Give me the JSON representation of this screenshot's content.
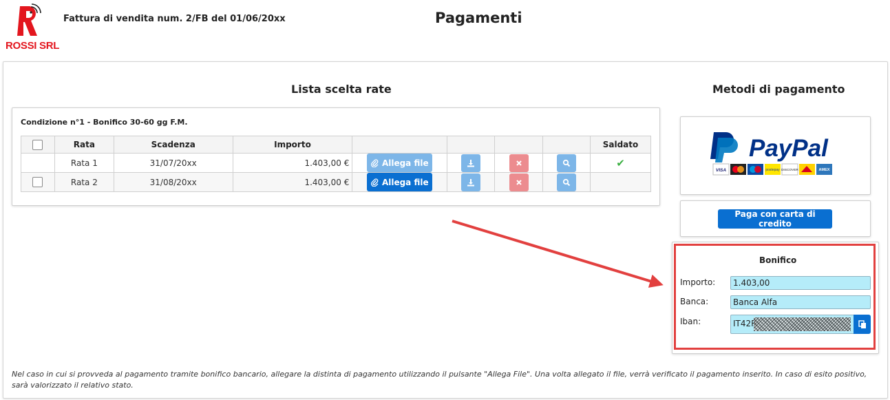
{
  "header": {
    "company": "ROSSI SRL",
    "invoice": "Fattura di vendita num. 2/FB del 01/06/20xx",
    "title": "Pagamenti"
  },
  "installments": {
    "section_title": "Lista scelta rate",
    "condition": "Condizione n°1 - Bonifico 30-60 gg F.M.",
    "columns": [
      "Rata",
      "Scadenza",
      "Importo",
      "Saldato"
    ],
    "attach_label": "Allega file",
    "rows": [
      {
        "rata": "Rata 1",
        "scadenza": "31/07/20xx",
        "importo": "1.403,00 €",
        "saldato": true,
        "attach_enabled": false
      },
      {
        "rata": "Rata 2",
        "scadenza": "31/08/20xx",
        "importo": "1.403,00 €",
        "saldato": false,
        "attach_enabled": true
      }
    ]
  },
  "payment_methods": {
    "section_title": "Metodi di pagamento",
    "paypal_brand": "PayPal",
    "card_logos": [
      "VISA",
      "Mastercard",
      "Maestro",
      "PostePay",
      "DISCOVER",
      "Aura",
      "AMEX"
    ],
    "credit_card_button": "Paga con carta di credito",
    "bonifico": {
      "title": "Bonifico",
      "importo_label": "Importo:",
      "importo_value": "1.403,00",
      "banca_label": "Banca:",
      "banca_value": "Banca Alfa",
      "iban_label": "Iban:",
      "iban_value": "IT42R"
    }
  },
  "footnote": "Nel caso in cui si provveda al pagamento tramite bonifico bancario, allegare la distinta di pagamento utilizzando il pulsante \"Allega File\". Una volta allegato il file, verrà verificato il pagamento inserito. In caso di esito positivo, sarà valorizzato il relativo stato.",
  "colors": {
    "primary": "#0a6fd1",
    "primary_disabled": "#7db6e8",
    "danger_disabled": "#ec8c8f",
    "highlight": "#e2403f",
    "input_bg": "#b5ecf9",
    "success": "#3cb043",
    "logo_red": "#e3161e"
  }
}
